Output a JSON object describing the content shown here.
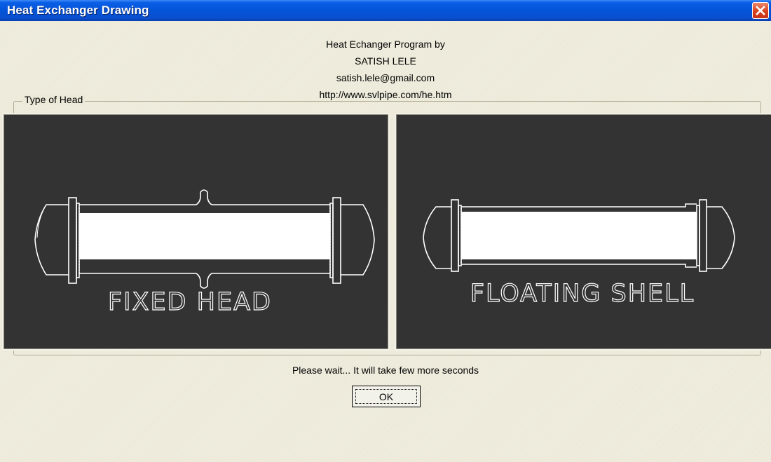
{
  "window": {
    "title": "Heat Exchanger Drawing",
    "close_icon": "close-icon"
  },
  "header": {
    "lines": [
      "Heat Echanger Program by",
      "SATISH LELE",
      "satish.lele@gmail.com",
      "http://www.svlpipe.com/he.htm"
    ]
  },
  "group": {
    "label": "Type of Head"
  },
  "panels": [
    {
      "label": "FIXED HEAD",
      "icon": "fixed-head-exchanger-drawing"
    },
    {
      "label": "FLOATING SHELL",
      "icon": "floating-shell-exchanger-drawing"
    }
  ],
  "status": {
    "message": "Please wait... It will take few more seconds"
  },
  "buttons": {
    "ok_label": "OK"
  },
  "colors": {
    "titlebar": "#0454d8",
    "dialog_bg": "#ece9d8",
    "panel_bg": "#333333",
    "close_button": "#d8401c"
  }
}
